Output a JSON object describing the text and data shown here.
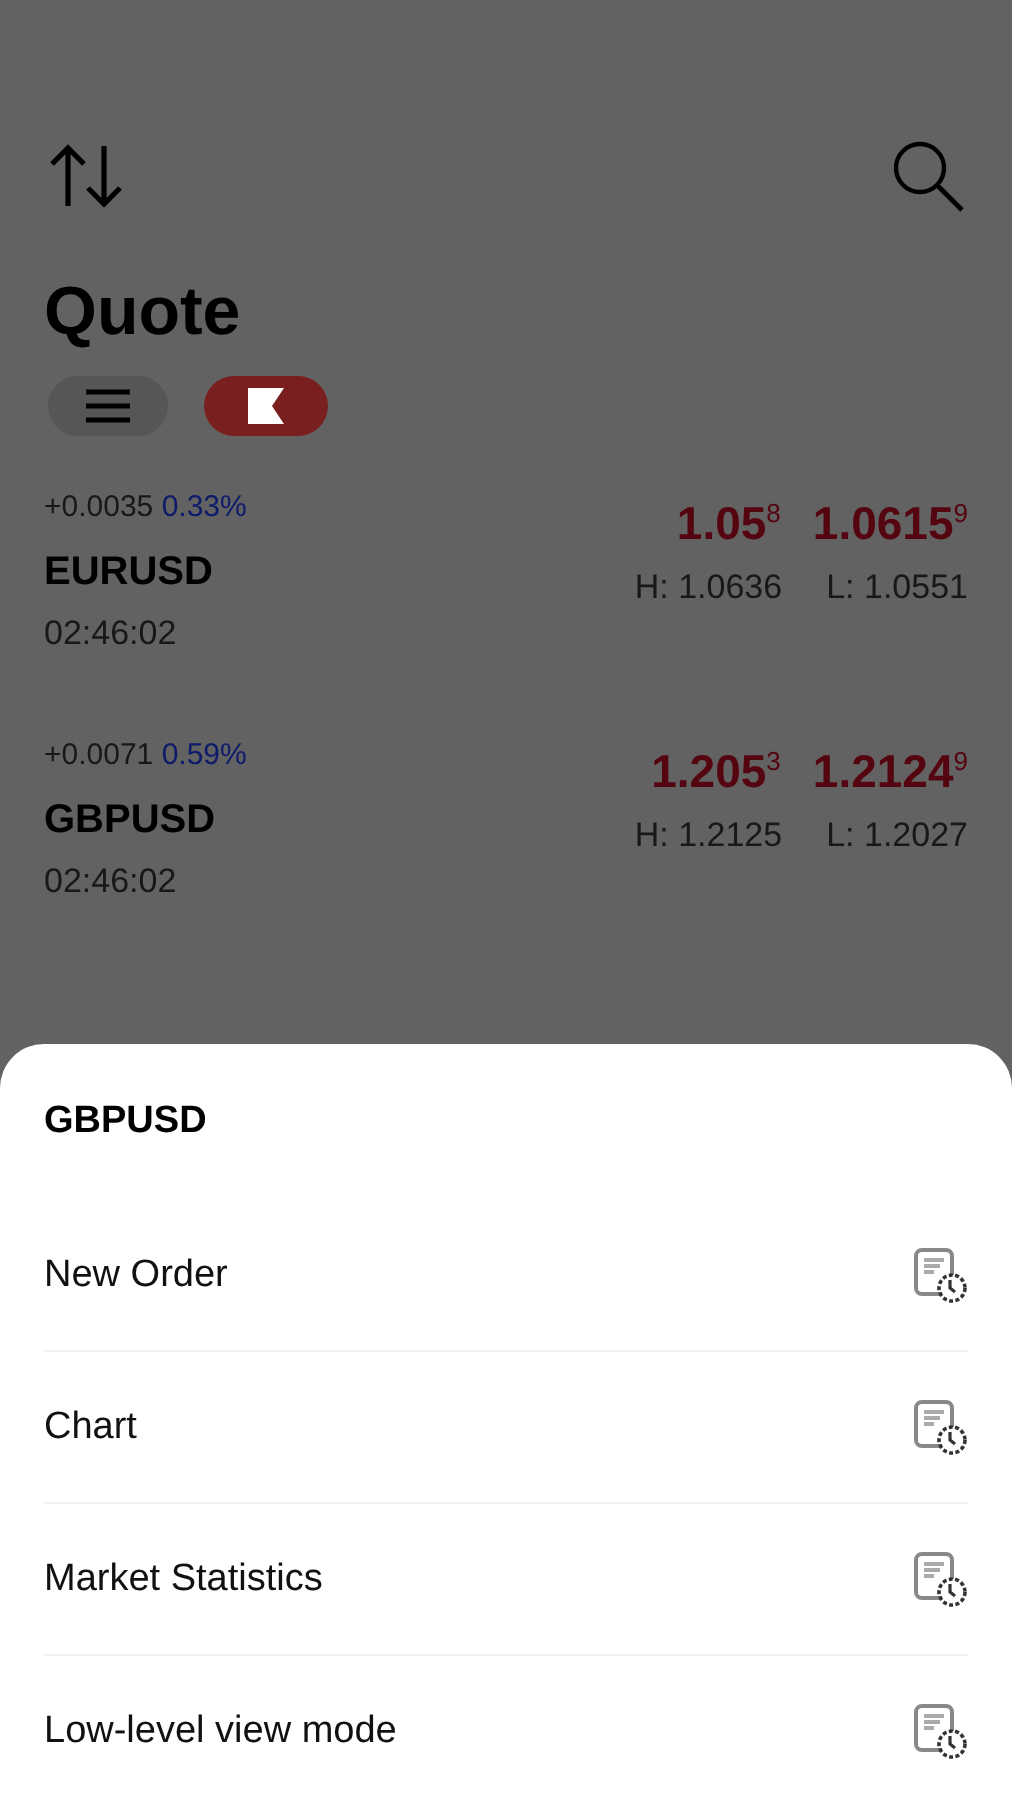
{
  "header": {
    "title": "Quote"
  },
  "view_toggle": {
    "on": true
  },
  "quotes": [
    {
      "symbol": "EURUSD",
      "change": "+0.0035",
      "percent": "0.33%",
      "time": "02:46:02",
      "bid": "1.05$^{8}$",
      "ask": "1.0615$^{9}$",
      "high": "H: 1.0636",
      "low": "L: 1.0551"
    },
    {
      "symbol": "GBPUSD",
      "change": "+0.0071",
      "percent": "0.59%",
      "time": "02:46:02",
      "bid": "1.205$^{3}$",
      "ask": "1.2124$^{9}$",
      "high": "H: 1.2125",
      "low": "L: 1.2027"
    }
  ],
  "sheet": {
    "title": "GBPUSD",
    "items": [
      {
        "label": "New Order"
      },
      {
        "label": "Chart"
      },
      {
        "label": "Market Statistics"
      },
      {
        "label": "Low-level view mode"
      }
    ]
  }
}
